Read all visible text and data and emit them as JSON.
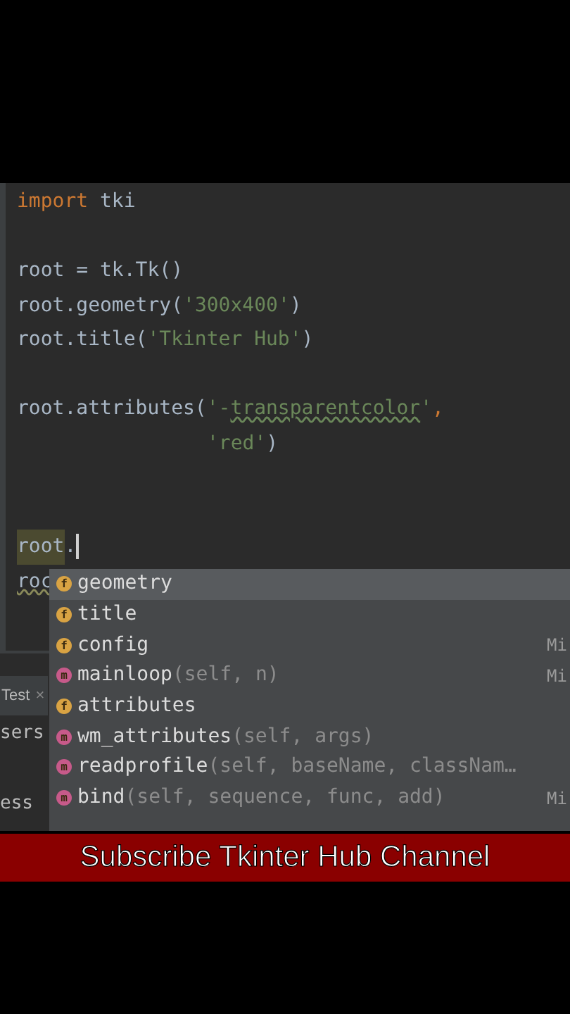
{
  "editor": {
    "lines": [
      {
        "kind": "code",
        "tokens": [
          {
            "kind": "keyword",
            "text": "import"
          },
          {
            "kind": "plain",
            "text": " tki"
          }
        ]
      },
      {
        "kind": "blank"
      },
      {
        "kind": "code",
        "tokens": [
          {
            "kind": "plain",
            "text": "root = tk.Tk()"
          }
        ]
      },
      {
        "kind": "code",
        "tokens": [
          {
            "kind": "plain",
            "text": "root.geometry("
          },
          {
            "kind": "string",
            "text": "'300x400'"
          },
          {
            "kind": "plain",
            "text": ")"
          }
        ]
      },
      {
        "kind": "code",
        "tokens": [
          {
            "kind": "plain",
            "text": "root.title("
          },
          {
            "kind": "string",
            "text": "'Tkinter Hub'"
          },
          {
            "kind": "plain",
            "text": ")"
          }
        ]
      },
      {
        "kind": "blank"
      },
      {
        "kind": "code",
        "tokens": [
          {
            "kind": "plain",
            "text": "root.attributes("
          },
          {
            "kind": "string",
            "text": "'-"
          },
          {
            "kind": "string_underlined",
            "text": "transparentcolor"
          },
          {
            "kind": "string",
            "text": "'"
          },
          {
            "kind": "keyword",
            "text": ","
          }
        ]
      },
      {
        "kind": "code",
        "indent": true,
        "tokens": [
          {
            "kind": "string",
            "text": "'red'"
          },
          {
            "kind": "plain",
            "text": ")"
          }
        ]
      },
      {
        "kind": "blank"
      },
      {
        "kind": "blank"
      },
      {
        "kind": "code",
        "caret": true,
        "tokens": [
          {
            "kind": "highlight",
            "text": "root"
          },
          {
            "kind": "plain",
            "text": "."
          }
        ]
      },
      {
        "kind": "code",
        "tokens": [
          {
            "kind": "underlined",
            "text": "roc"
          }
        ]
      }
    ]
  },
  "run_panel": {
    "tab": {
      "label": "Test",
      "close": "×"
    },
    "lines": [
      {
        "kind": "text",
        "text": "sers"
      },
      {
        "kind": "blank"
      },
      {
        "kind": "text",
        "text": "ess"
      }
    ]
  },
  "completion": {
    "items": [
      {
        "kind": "field",
        "badge": "f",
        "name": "geometry",
        "selected": true
      },
      {
        "kind": "field",
        "badge": "f",
        "name": "title",
        "selected": false
      },
      {
        "kind": "field",
        "badge": "f",
        "name": "config",
        "type": "Mi",
        "selected": false
      },
      {
        "kind": "method",
        "badge": "m",
        "name": "mainloop",
        "params": "(self, n)",
        "type": "Mi",
        "selected": false
      },
      {
        "kind": "field",
        "badge": "f",
        "name": "attributes",
        "selected": false
      },
      {
        "kind": "method",
        "badge": "m",
        "name": "wm_attributes",
        "params": "(self, args)",
        "selected": false
      },
      {
        "kind": "method",
        "badge": "m",
        "name": "readprofile",
        "params": "(self, baseName, classNam…",
        "selected": false
      },
      {
        "kind": "method",
        "badge": "m",
        "name": "bind",
        "params": "(self, sequence, func, add)",
        "type": "Mi",
        "selected": false
      }
    ]
  },
  "banner": {
    "text": "Subscribe Tkinter Hub Channel"
  }
}
